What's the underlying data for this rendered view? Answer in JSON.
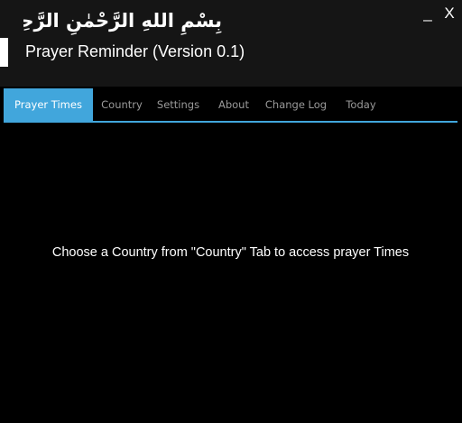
{
  "window": {
    "bismillah": "بِسْمِ اللهِ الرَّحْمٰنِ الرَّحِيْمِ",
    "title": "Prayer Reminder (Version 0.1)",
    "minimize_label": "_",
    "close_label": "X"
  },
  "tabs": {
    "prayer_times": "Prayer Times",
    "country": "Country",
    "settings": "Settings",
    "about": "About",
    "change_log": "Change Log",
    "today": "Today"
  },
  "main": {
    "message": "Choose a Country from \"Country\" Tab to access prayer Times"
  },
  "colors": {
    "accent": "#41a6dc",
    "titlebar_background": "#151515",
    "content_background": "#000000",
    "text": "#ffffff",
    "inactive_tab_text": "#9a9a9a"
  }
}
